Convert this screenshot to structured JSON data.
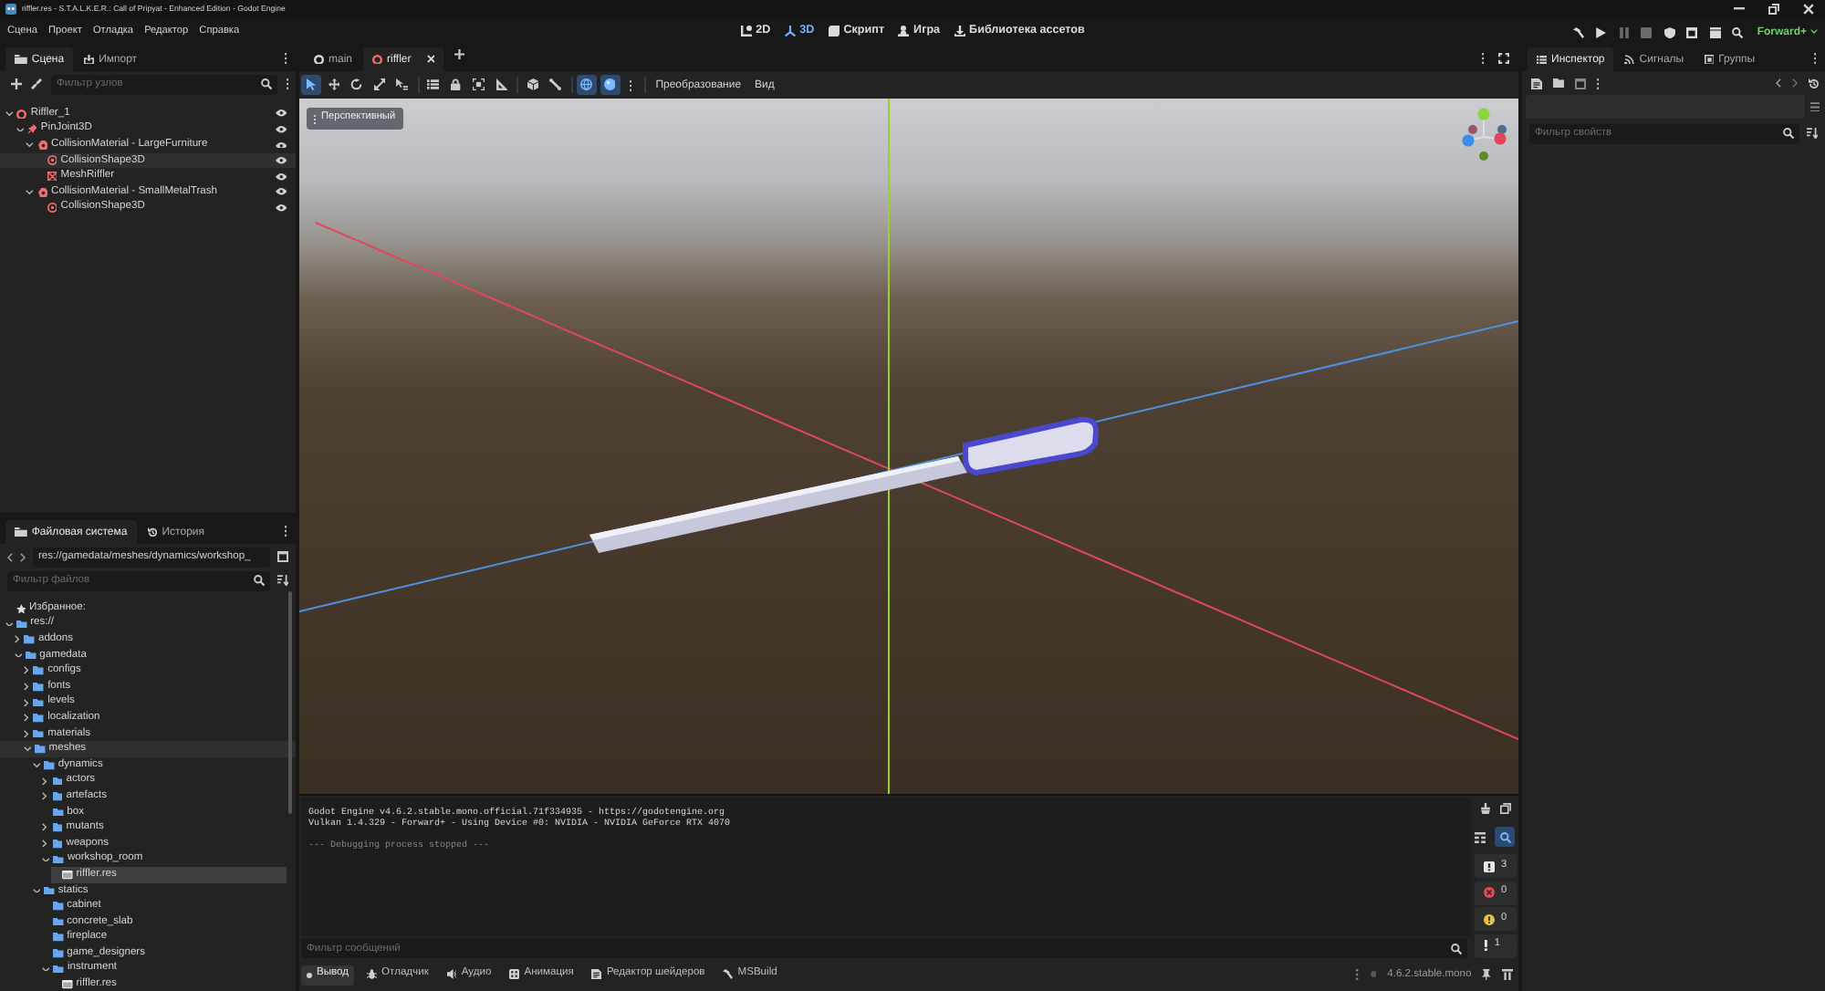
{
  "window": {
    "title": "riffler.res - S.T.A.L.K.E.R.: Call of Pripyat - Enhanced Edition - Godot Engine"
  },
  "menu": [
    "Сцена",
    "Проект",
    "Отладка",
    "Редактор",
    "Справка"
  ],
  "main_screens": [
    {
      "label": "2D",
      "kind": "flat",
      "selected": false
    },
    {
      "label": "3D",
      "kind": "spatial",
      "selected": true
    },
    {
      "label": "Скрипт",
      "kind": "script",
      "selected": false
    },
    {
      "label": "Игра",
      "kind": "game",
      "selected": false
    },
    {
      "label": "Библиотека ассетов",
      "kind": "assetlib",
      "selected": false
    }
  ],
  "run_bar": {
    "buttons": [
      {
        "kind": "build",
        "disabled": false
      },
      {
        "kind": "play",
        "disabled": false
      },
      {
        "kind": "pause",
        "disabled": true
      },
      {
        "kind": "stop",
        "disabled": true
      },
      {
        "kind": "remote",
        "disabled": false
      },
      {
        "kind": "scene",
        "disabled": false
      },
      {
        "kind": "custom",
        "disabled": false
      },
      {
        "kind": "movie",
        "disabled": false
      }
    ],
    "renderer": "Forward+"
  },
  "scene_dock": {
    "tabs": [
      {
        "label": "Сцена",
        "kind": "scene",
        "selected": true
      },
      {
        "label": "Импорт",
        "kind": "import",
        "selected": false
      }
    ],
    "filter": {
      "placeholder": "Фильтр узлов"
    },
    "tree": [
      {
        "label": "Riffler_1",
        "kind": "body",
        "expanded": true,
        "highlighted": false,
        "visible": true,
        "children": [
          {
            "label": "PinJoint3D",
            "kind": "joint",
            "expanded": true,
            "highlighted": false,
            "visible": true,
            "children": [
              {
                "label": "CollisionMaterial - LargeFurniture",
                "kind": "material",
                "expanded": true,
                "highlighted": false,
                "visible": true,
                "children": [
                  {
                    "label": "CollisionShape3D",
                    "kind": "shape",
                    "highlighted": true,
                    "visible": true
                  },
                  {
                    "label": "MeshRiffler",
                    "kind": "mesh",
                    "highlighted": false,
                    "visible": true
                  }
                ]
              },
              {
                "label": "CollisionMaterial - SmallMetalTrash",
                "kind": "material",
                "expanded": true,
                "highlighted": false,
                "visible": true,
                "children": [
                  {
                    "label": "CollisionShape3D",
                    "kind": "shape",
                    "highlighted": false,
                    "visible": true
                  }
                ]
              }
            ]
          }
        ]
      }
    ]
  },
  "filesystem_dock": {
    "tabs": [
      {
        "label": "Файловая система",
        "kind": "files",
        "selected": true
      },
      {
        "label": "История",
        "kind": "history",
        "selected": false
      }
    ],
    "path": "res://gamedata/meshes/dynamics/workshop_",
    "filter": {
      "placeholder": "Фильтр файлов"
    },
    "tree": [
      {
        "label": "Избранное:",
        "kind": "favorites",
        "selected": false,
        "highlighted": false
      },
      {
        "label": "res://",
        "kind": "folder",
        "expanded": true,
        "selected": false,
        "highlighted": false,
        "children": [
          {
            "label": "addons",
            "kind": "folder",
            "expanded": false,
            "selected": false,
            "highlighted": false
          },
          {
            "label": "gamedata",
            "kind": "folder",
            "expanded": true,
            "selected": false,
            "highlighted": false,
            "children": [
              {
                "label": "configs",
                "kind": "folder",
                "expanded": false,
                "selected": false,
                "highlighted": false
              },
              {
                "label": "fonts",
                "kind": "folder",
                "expanded": false,
                "selected": false,
                "highlighted": false
              },
              {
                "label": "levels",
                "kind": "folder",
                "expanded": false,
                "selected": false,
                "highlighted": false
              },
              {
                "label": "localization",
                "kind": "folder",
                "expanded": false,
                "selected": false,
                "highlighted": false
              },
              {
                "label": "materials",
                "kind": "folder",
                "expanded": false,
                "selected": false,
                "highlighted": false
              },
              {
                "label": "meshes",
                "kind": "folder",
                "expanded": true,
                "selected": false,
                "highlighted": true,
                "children": [
                  {
                    "label": "dynamics",
                    "kind": "folder",
                    "expanded": true,
                    "selected": false,
                    "highlighted": false,
                    "children": [
                      {
                        "label": "actors",
                        "kind": "folder",
                        "expanded": false,
                        "selected": false,
                        "highlighted": false
                      },
                      {
                        "label": "artefacts",
                        "kind": "folder",
                        "expanded": false,
                        "selected": false,
                        "highlighted": false
                      },
                      {
                        "label": "box",
                        "kind": "folder",
                        "selected": false,
                        "highlighted": false
                      },
                      {
                        "label": "mutants",
                        "kind": "folder",
                        "expanded": false,
                        "selected": false,
                        "highlighted": false
                      },
                      {
                        "label": "weapons",
                        "kind": "folder",
                        "expanded": false,
                        "selected": false,
                        "highlighted": false
                      },
                      {
                        "label": "workshop_room",
                        "kind": "folder",
                        "expanded": true,
                        "selected": false,
                        "highlighted": false,
                        "children": [
                          {
                            "label": "riffler.res",
                            "kind": "file",
                            "selected": true,
                            "highlighted": false
                          }
                        ]
                      }
                    ]
                  },
                  {
                    "label": "statics",
                    "kind": "folder",
                    "expanded": true,
                    "selected": false,
                    "highlighted": false,
                    "children": [
                      {
                        "label": "cabinet",
                        "kind": "folder",
                        "selected": false,
                        "highlighted": false
                      },
                      {
                        "label": "concrete_slab",
                        "kind": "folder",
                        "selected": false,
                        "highlighted": false
                      },
                      {
                        "label": "fireplace",
                        "kind": "folder",
                        "selected": false,
                        "highlighted": false
                      },
                      {
                        "label": "game_designers",
                        "kind": "folder",
                        "selected": false,
                        "highlighted": false
                      },
                      {
                        "label": "instrument",
                        "kind": "folder",
                        "expanded": true,
                        "selected": false,
                        "highlighted": false,
                        "children": [
                          {
                            "label": "riffler.res",
                            "kind": "file",
                            "selected": false,
                            "highlighted": false
                          }
                        ]
                      }
                    ]
                  }
                ]
              }
            ]
          }
        ]
      }
    ]
  },
  "editor_tabs": [
    {
      "label": "main",
      "kind": "node",
      "selected": false
    },
    {
      "label": "riffler",
      "kind": "body",
      "selected": true
    }
  ],
  "viewport_toolbar": {
    "tool_groups": [
      [
        {
          "kind": "select",
          "on": true
        },
        {
          "kind": "move",
          "on": false
        },
        {
          "kind": "rotate",
          "on": false
        },
        {
          "kind": "scale",
          "on": false
        },
        {
          "kind": "pick",
          "on": false
        }
      ],
      [
        {
          "kind": "list",
          "on": false
        },
        {
          "kind": "lock",
          "on": false
        },
        {
          "kind": "group",
          "on": false
        },
        {
          "kind": "ruler",
          "on": false
        }
      ],
      [
        {
          "kind": "cube",
          "on": false
        },
        {
          "kind": "bone",
          "on": false
        }
      ],
      [
        {
          "kind": "local",
          "on": true
        },
        {
          "kind": "sphere",
          "on": true
        }
      ]
    ],
    "menus": [
      "Преобразование",
      "Вид"
    ]
  },
  "viewport": {
    "view_menu": "Перспективный"
  },
  "output": {
    "lines": [
      {
        "text": "Godot Engine v4.6.2.stable.mono.official.71f334935 - https://godotengine.org",
        "kind": "info"
      },
      {
        "text": "Vulkan 1.4.329 - Forward+ - Using Device #0: NVIDIA - NVIDIA GeForce RTX 4070",
        "kind": "info"
      },
      {
        "text": "--- Debugging process stopped ---",
        "kind": "note"
      }
    ],
    "filter": {
      "placeholder": "Фильтр сообщений"
    },
    "search_on": true,
    "counters": [
      {
        "kind": "message",
        "count": "3"
      },
      {
        "kind": "error",
        "count": "0"
      },
      {
        "kind": "warning",
        "count": "0"
      },
      {
        "kind": "editor",
        "count": "1"
      }
    ]
  },
  "bottom_panel": {
    "tabs": [
      {
        "label": "Вывод",
        "kind": "output",
        "selected": true
      },
      {
        "label": "Отладчик",
        "kind": "debugger",
        "selected": false
      },
      {
        "label": "Аудио",
        "kind": "audio",
        "selected": false
      },
      {
        "label": "Анимация",
        "kind": "animation",
        "selected": false
      },
      {
        "label": "Редактор шейдеров",
        "kind": "shader",
        "selected": false
      },
      {
        "label": "MSBuild",
        "kind": "build",
        "selected": false
      }
    ],
    "version": "4.6.2.stable.mono"
  },
  "inspector": {
    "tabs": [
      {
        "label": "Инспектор",
        "kind": "inspector",
        "selected": true
      },
      {
        "label": "Сигналы",
        "kind": "signals",
        "selected": false
      },
      {
        "label": "Группы",
        "kind": "groups",
        "selected": false
      }
    ],
    "filter": {
      "placeholder": "Фильтр свойств"
    }
  }
}
